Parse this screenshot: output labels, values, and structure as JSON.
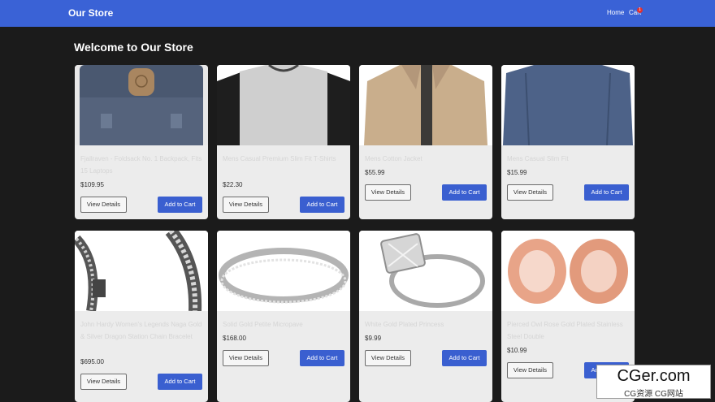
{
  "navbar": {
    "brand": "Our Store",
    "home": "Home",
    "cart": "Cart",
    "cart_count": "1"
  },
  "page_title": "Welcome to Our Store",
  "buttons": {
    "view_details": "View Details",
    "add_to_cart": "Add to Cart"
  },
  "products": [
    {
      "name": "Fjallraven - Foldsack No. 1 Backpack, Fits 15 Laptops",
      "price": "$109.95"
    },
    {
      "name": "Mens Casual Premium Slim Fit T-Shirts",
      "price": "$22.30"
    },
    {
      "name": "Mens Cotton Jacket",
      "price": "$55.99"
    },
    {
      "name": "Mens Casual Slim Fit",
      "price": "$15.99"
    },
    {
      "name": "John Hardy Women's Legends Naga Gold & Silver Dragon Station Chain Bracelet",
      "price": "$695.00"
    },
    {
      "name": "Solid Gold Petite Micropave",
      "price": "$168.00"
    },
    {
      "name": "White Gold Plated Princess",
      "price": "$9.99"
    },
    {
      "name": "Pierced Owl Rose Gold Plated Stainless Steel Double",
      "price": "$10.99"
    }
  ],
  "watermark": {
    "main": "CGer.com",
    "sub": "CG资源 CG网站"
  }
}
